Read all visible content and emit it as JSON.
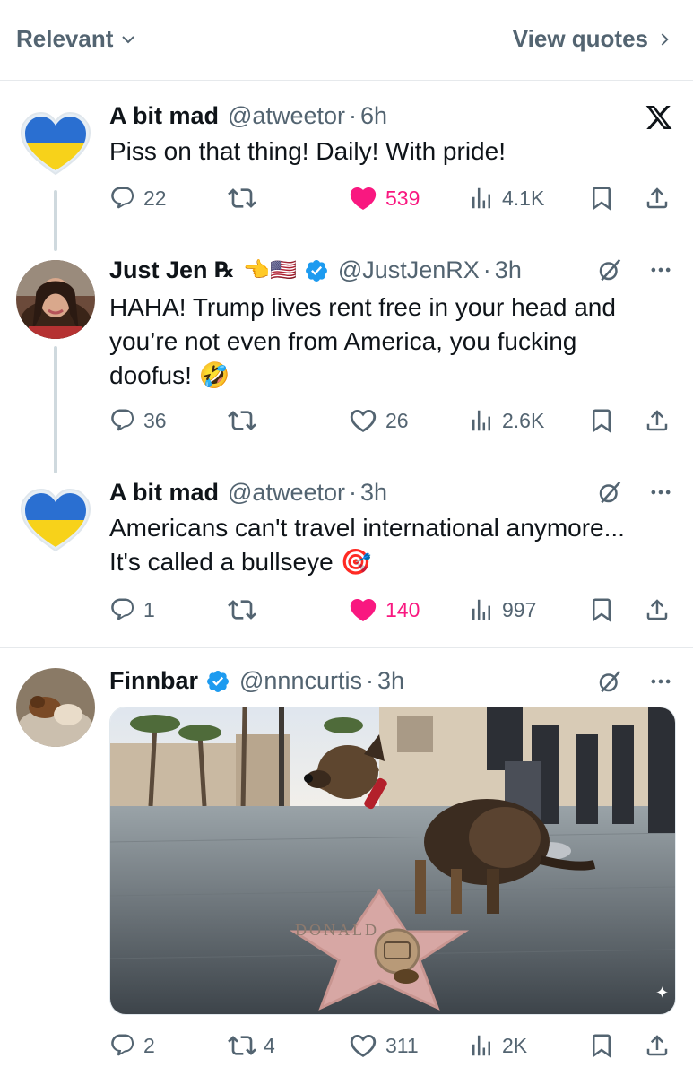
{
  "topbar": {
    "sort_label": "Relevant",
    "quotes_label": "View quotes"
  },
  "posts": [
    {
      "name": "A bit mad",
      "handle": "@atweetor",
      "time": "6h",
      "text": "Piss on that thing! Daily! With pride!",
      "replies": "22",
      "reposts": "",
      "likes": "539",
      "views": "4.1K",
      "liked": true
    },
    {
      "name": "Just Jen",
      "name_suffix": "℞",
      "handle": "@JustJenRX",
      "time": "3h",
      "text": "HAHA! Trump lives rent free in your head and you’re not even from America, you fucking doofus! 🤣",
      "replies": "36",
      "reposts": "",
      "likes": "26",
      "views": "2.6K",
      "liked": false
    },
    {
      "name": "A bit mad",
      "handle": "@atweetor",
      "time": "3h",
      "text_line1": "Americans can't travel international anymore...",
      "text_line2": "It's called a bullseye 🎯",
      "replies": "1",
      "reposts": "",
      "likes": "140",
      "views": "997",
      "liked": true
    },
    {
      "name": "Finnbar",
      "handle": "@nnncurtis",
      "time": "3h",
      "star_text": "DONALD",
      "replies": "2",
      "reposts": "4",
      "likes": "311",
      "views": "2K",
      "liked": false
    }
  ],
  "colors": {
    "like_pink": "#f91880",
    "verified_blue": "#1d9bf0",
    "muted": "#536471"
  },
  "icons": [
    "chevron-down-icon",
    "chevron-right-icon",
    "x-logo-icon",
    "reply-icon",
    "repost-icon",
    "heart-icon",
    "views-icon",
    "bookmark-icon",
    "share-icon",
    "grok-icon",
    "more-icon",
    "verified-badge-icon"
  ]
}
